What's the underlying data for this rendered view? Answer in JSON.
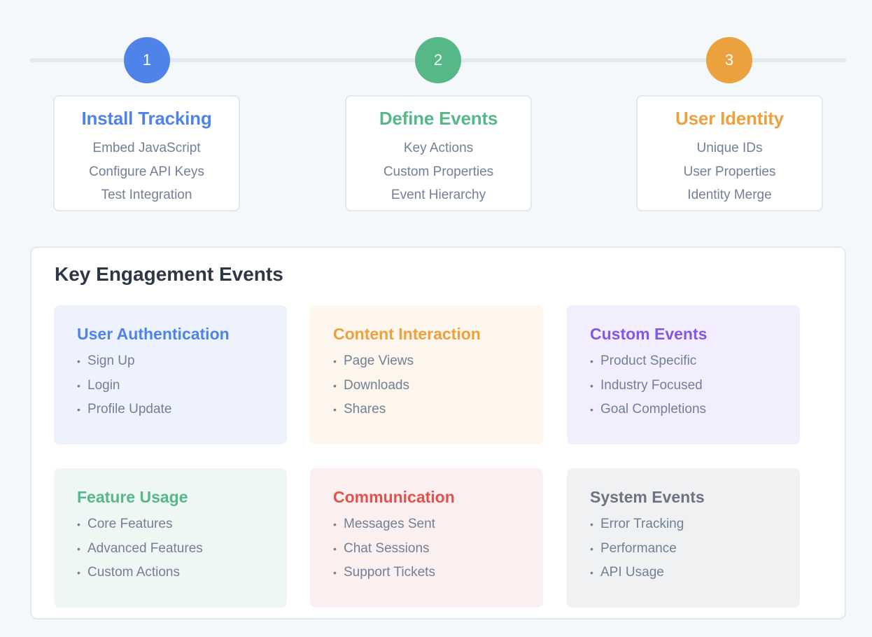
{
  "steps": [
    {
      "number": "1",
      "title": "Install Tracking",
      "color": "#4f83ea",
      "items": [
        "Embed JavaScript",
        "Configure API Keys",
        "Test Integration"
      ]
    },
    {
      "number": "2",
      "title": "Define Events",
      "color": "#55b886",
      "items": [
        "Key Actions",
        "Custom Properties",
        "Event Hierarchy"
      ]
    },
    {
      "number": "3",
      "title": "User Identity",
      "color": "#eba13e",
      "items": [
        "Unique IDs",
        "User Properties",
        "Identity Merge"
      ]
    }
  ],
  "panel": {
    "title": "Key Engagement Events",
    "bullet": "•",
    "cards": [
      {
        "title": "User Authentication",
        "color": "#4f83ea",
        "bg": "#edf2fd",
        "items": [
          "Sign Up",
          "Login",
          "Profile Update"
        ]
      },
      {
        "title": "Content Interaction",
        "color": "#eba13e",
        "bg": "#fdf6ec",
        "items": [
          "Page Views",
          "Downloads",
          "Shares"
        ]
      },
      {
        "title": "Custom Events",
        "color": "#8458e6",
        "bg": "#f2eefd",
        "items": [
          "Product Specific",
          "Industry Focused",
          "Goal Completions"
        ]
      },
      {
        "title": "Feature Usage",
        "color": "#55b886",
        "bg": "#eef7f3",
        "items": [
          "Core Features",
          "Advanced Features",
          "Custom Actions"
        ]
      },
      {
        "title": "Communication",
        "color": "#e2524c",
        "bg": "#fcefef",
        "items": [
          "Messages Sent",
          "Chat Sessions",
          "Support Tickets"
        ]
      },
      {
        "title": "System Events",
        "color": "#6b7385",
        "bg": "#f0f1f3",
        "items": [
          "Error Tracking",
          "Performance",
          "API Usage"
        ]
      }
    ]
  }
}
